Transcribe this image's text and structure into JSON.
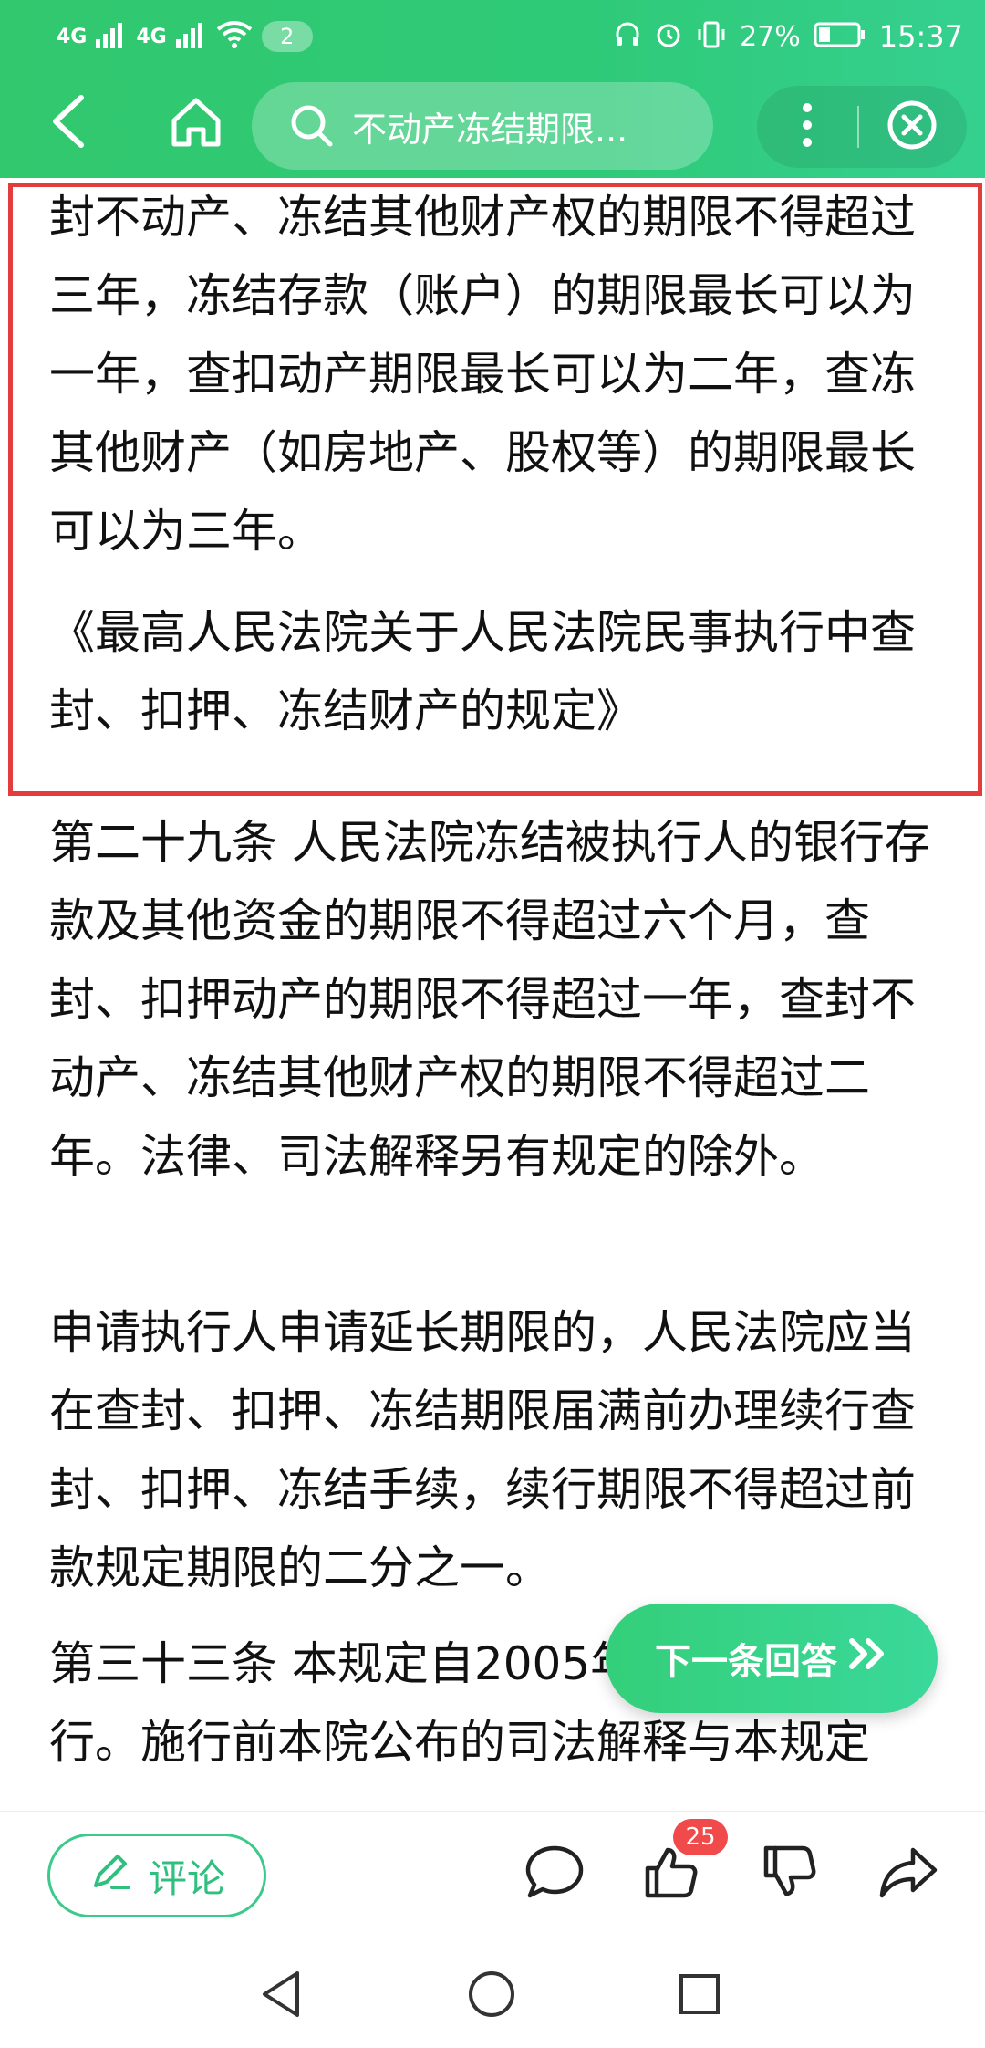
{
  "status_bar": {
    "signal_1": "4G",
    "signal_2": "4G",
    "notification_count": "2",
    "battery_percent": "27%",
    "time": "15:37",
    "icons": [
      "signal-icon",
      "signal-icon",
      "wifi-icon",
      "headphones-icon",
      "alarm-icon",
      "vibrate-icon",
      "battery-icon"
    ]
  },
  "header": {
    "search_text": "不动产冻结期限...",
    "icons": [
      "back-arrow-icon",
      "home-icon",
      "search-icon",
      "more-vertical-icon",
      "close-circle-icon"
    ],
    "accent_color": "#33c977"
  },
  "content": {
    "highlight_color": "#e23c3c",
    "paragraphs": [
      "封不动产、冻结其他财产权的期限不得超过三年，冻结存款（账户）的期限最长可以为一年，查扣动产期限最长可以为二年，查冻其他财产（如房地产、股权等）的期限最长可以为三年。",
      "《最高人民法院关于人民法院民事执行中查封、扣押、冻结财产的规定》",
      "第二十九条 人民法院冻结被执行人的银行存款及其他资金的期限不得超过六个月，查封、扣押动产的期限不得超过一年，查封不动产、冻结其他财产权的期限不得超过二年。法律、司法解释另有规定的除外。",
      "申请执行人申请延长期限的，人民法院应当在查封、扣押、冻结期限届满前办理续行查封、扣押、冻结手续，续行期限不得超过前款规定期限的二分之一。",
      "第三十三条 本规定自2005年1月1日起施行。施行前本院公布的司法解释与本规定"
    ]
  },
  "next_answer": {
    "label": "下一条回答",
    "icon": "double-chevron-right-icon"
  },
  "bottom_bar": {
    "comment_label": "评论",
    "like_count": "25",
    "icons": [
      "pen-icon",
      "comment-bubble-icon",
      "thumbs-up-icon",
      "thumbs-down-icon",
      "share-icon"
    ]
  },
  "nav_bar": {
    "icons": [
      "nav-back-icon",
      "nav-home-icon",
      "nav-recents-icon"
    ]
  }
}
